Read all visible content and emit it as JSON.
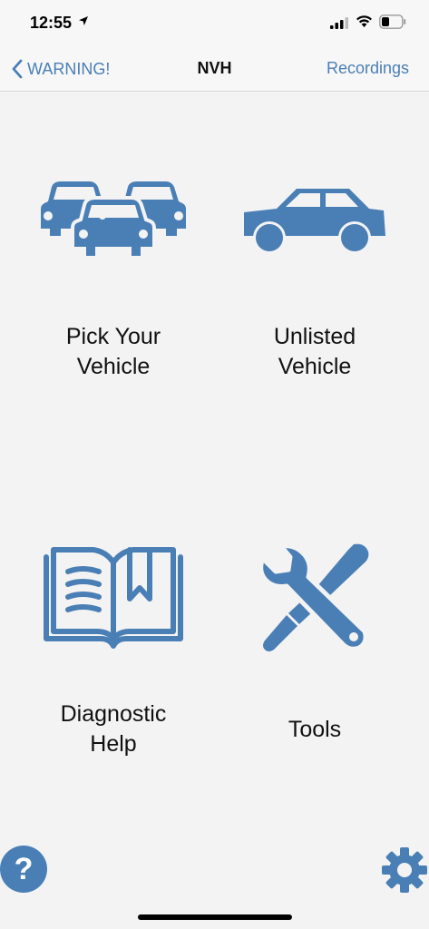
{
  "status_bar": {
    "time": "12:55",
    "icons": [
      "location-arrow-icon",
      "cellular-signal-icon",
      "wifi-icon",
      "battery-icon"
    ]
  },
  "nav": {
    "back_label": "WARNING!",
    "title": "NVH",
    "right_label": "Recordings"
  },
  "tiles": [
    {
      "label": "Pick Your\nVehicle",
      "icon": "multiple-cars-icon"
    },
    {
      "label": "Unlisted\nVehicle",
      "icon": "car-side-icon"
    },
    {
      "label": "Diagnostic\nHelp",
      "icon": "book-icon"
    },
    {
      "label": "Tools",
      "icon": "tools-icon"
    }
  ],
  "footer": {
    "help_glyph": "?",
    "help_icon": "help-icon",
    "settings_icon": "gear-icon"
  },
  "colors": {
    "accent": "#4a7fb6",
    "background": "#f3f3f3"
  }
}
